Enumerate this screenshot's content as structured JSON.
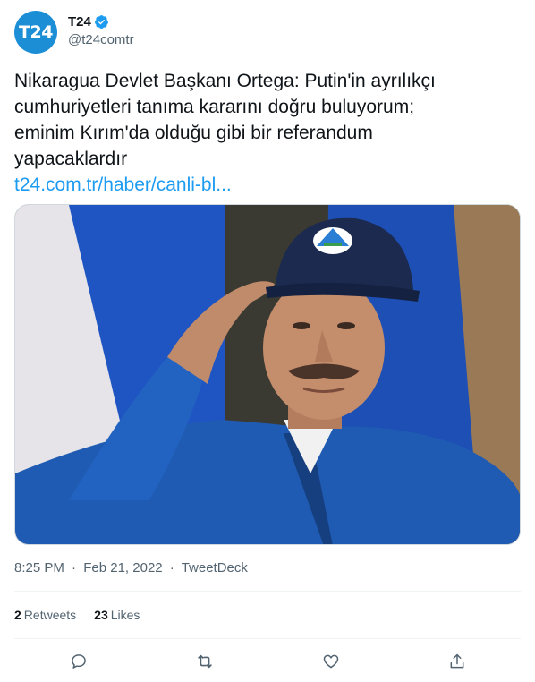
{
  "header": {
    "avatar_text": "T24",
    "display_name": "T24",
    "handle": "@t24comtr"
  },
  "tweet": {
    "lines": [
      "Nikaragua Devlet Başkanı Ortega: Putin'in ayrılıkçı",
      "cumhuriyetleri tanıma kararını doğru buluyorum;",
      "eminim Kırım'da olduğu gibi bir referandum",
      "yapacaklardır"
    ],
    "link": "t24.com.tr/haber/canli-bl..."
  },
  "meta": {
    "time": "8:25 PM",
    "date": "Feb 21, 2022",
    "source": "TweetDeck",
    "separator": "·"
  },
  "stats": {
    "retweets_count": "2",
    "retweets_label": "Retweets",
    "likes_count": "23",
    "likes_label": "Likes"
  },
  "icons": {
    "verified": "verified-badge-icon",
    "reply": "reply-icon",
    "retweet": "retweet-icon",
    "like": "heart-icon",
    "share": "share-icon"
  },
  "colors": {
    "avatar_bg": "#1c8ed6",
    "link": "#1d9bf0",
    "secondary_text": "#536471",
    "jacket": "#1f5bb3",
    "cap": "#1b2a4e"
  }
}
